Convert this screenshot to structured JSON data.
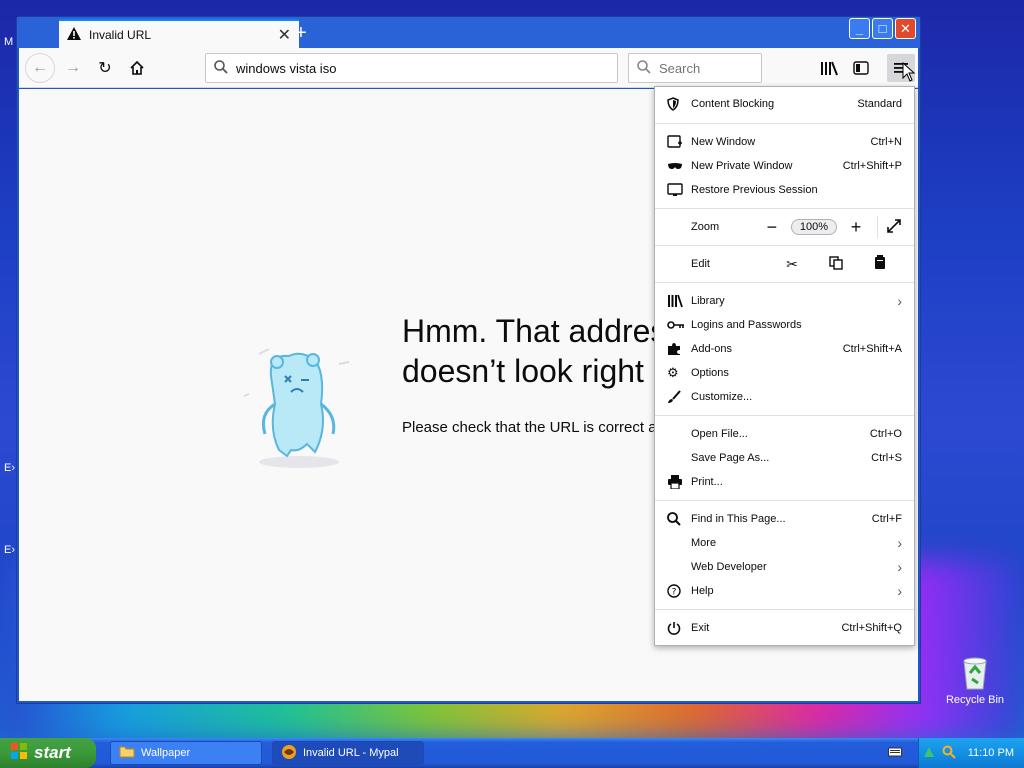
{
  "desktop": {
    "edge_letters": [
      "M",
      "E›",
      "E›"
    ],
    "recycle_bin_label": "Recycle Bin"
  },
  "browser": {
    "tab_title": "Invalid URL",
    "url_value": "windows vista iso",
    "search_placeholder": "Search",
    "error_title_line1": "Hmm. That address",
    "error_title_line2": "doesn’t look right",
    "error_desc": "Please check that the URL is correct and try again."
  },
  "menu": {
    "content_blocking": {
      "label": "Content Blocking",
      "value": "Standard"
    },
    "new_window": {
      "label": "New Window",
      "shortcut": "Ctrl+N"
    },
    "new_private": {
      "label": "New Private Window",
      "shortcut": "Ctrl+Shift+P"
    },
    "restore": {
      "label": "Restore Previous Session"
    },
    "zoom": {
      "label": "Zoom",
      "value": "100%"
    },
    "edit": {
      "label": "Edit"
    },
    "library": {
      "label": "Library"
    },
    "logins": {
      "label": "Logins and Passwords"
    },
    "addons": {
      "label": "Add-ons",
      "shortcut": "Ctrl+Shift+A"
    },
    "options": {
      "label": "Options"
    },
    "customize": {
      "label": "Customize..."
    },
    "open_file": {
      "label": "Open File...",
      "shortcut": "Ctrl+O"
    },
    "save_page": {
      "label": "Save Page As...",
      "shortcut": "Ctrl+S"
    },
    "print": {
      "label": "Print..."
    },
    "find": {
      "label": "Find in This Page...",
      "shortcut": "Ctrl+F"
    },
    "more": {
      "label": "More"
    },
    "web_dev": {
      "label": "Web Developer"
    },
    "help": {
      "label": "Help"
    },
    "exit": {
      "label": "Exit",
      "shortcut": "Ctrl+Shift+Q"
    }
  },
  "taskbar": {
    "start_label": "start",
    "task1_label": "Wallpaper",
    "task2_label": "Invalid URL - Mypal",
    "clock": "11:10 PM"
  }
}
